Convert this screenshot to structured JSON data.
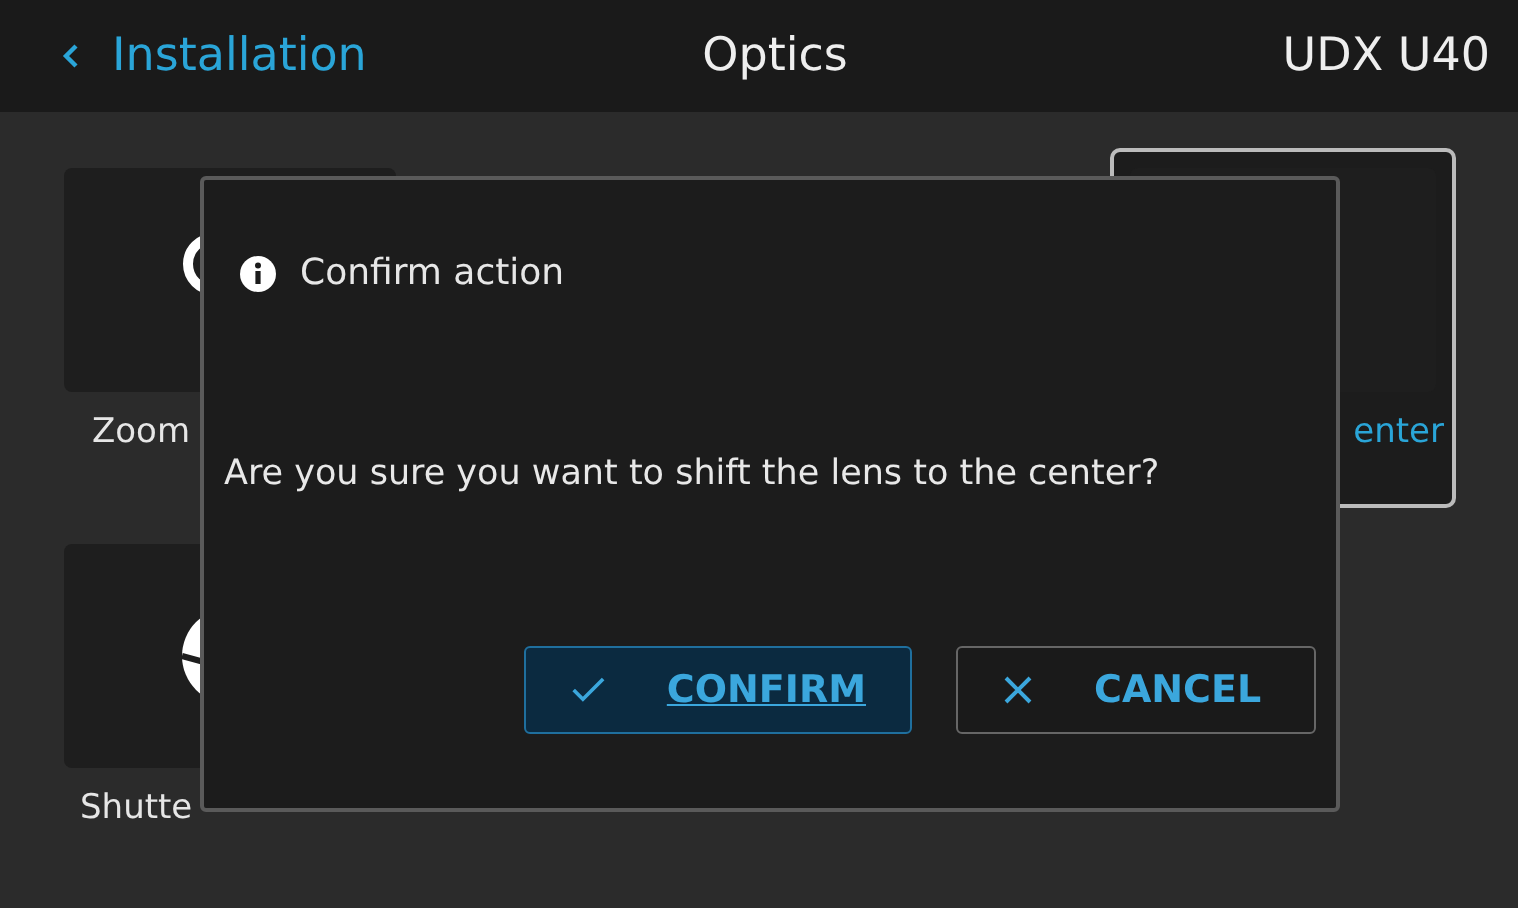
{
  "header": {
    "back_label": "Installation",
    "title": "Optics",
    "device": "UDX U40"
  },
  "tiles": [
    {
      "kind": "zoom",
      "label": "Zoom",
      "selected": false
    },
    {
      "kind": "center",
      "label": "enter",
      "selected": true
    },
    {
      "kind": "shutter",
      "label": "Shutte",
      "selected": false
    }
  ],
  "dialog": {
    "title": "Confirm action",
    "message": "Are you sure you want to shift the lens to the center?",
    "buttons": [
      {
        "kind": "confirm",
        "label": "CONFIRM"
      },
      {
        "kind": "cancel",
        "label": "CANCEL"
      }
    ]
  }
}
